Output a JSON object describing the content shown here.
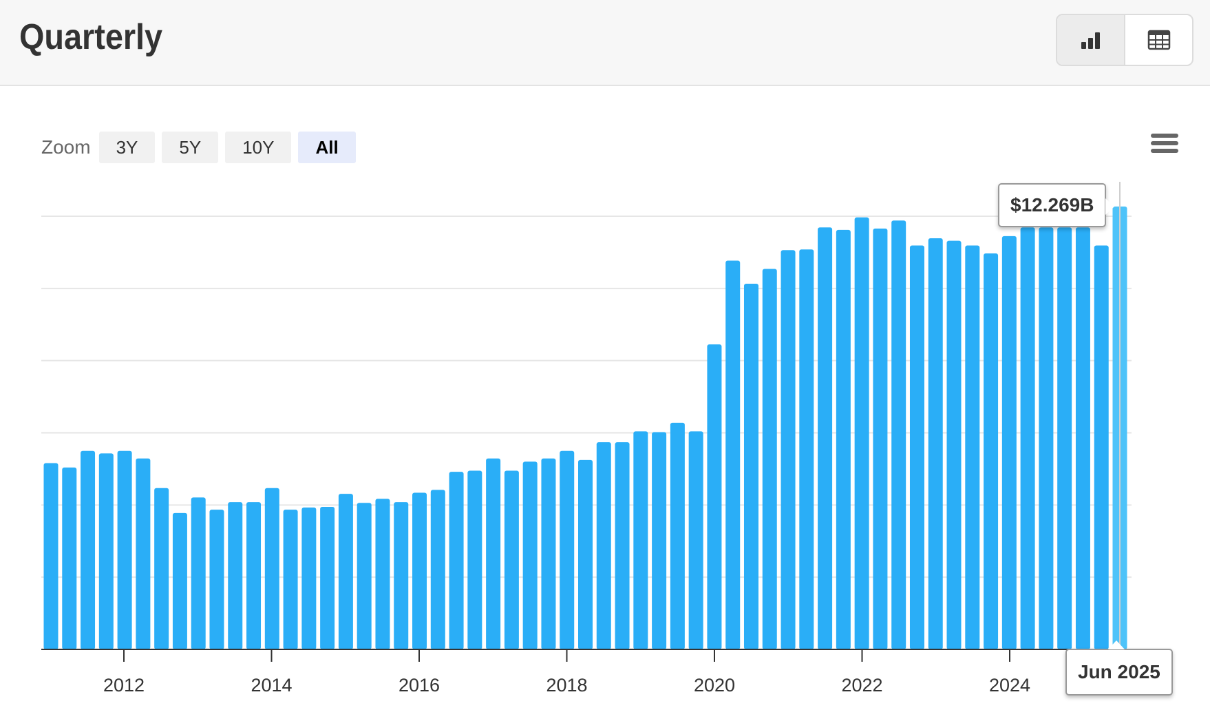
{
  "header": {
    "title": "Quarterly",
    "views": [
      {
        "name": "bar-chart-icon",
        "active": true
      },
      {
        "name": "table-icon",
        "active": false
      }
    ]
  },
  "zoom": {
    "label": "Zoom",
    "options": [
      "3Y",
      "5Y",
      "10Y",
      "All"
    ],
    "active": "All"
  },
  "menu": {
    "icon": "hamburger-menu-icon"
  },
  "tooltip": {
    "value": "$12.269B",
    "date": "Jun 2025"
  },
  "colors": {
    "bar": "#2aaef7",
    "highlight": "#4ec3f9",
    "grid": "#e6e6e6"
  },
  "chart_data": {
    "type": "bar",
    "title": "Quarterly",
    "xlabel": "",
    "ylabel": "",
    "x_ticks": [
      "2012",
      "2014",
      "2016",
      "2018",
      "2020",
      "2022",
      "2024"
    ],
    "x": [
      "Dec 2010",
      "Mar 2011",
      "Jun 2011",
      "Sep 2011",
      "Dec 2011",
      "Mar 2012",
      "Jun 2012",
      "Sep 2012",
      "Dec 2012",
      "Mar 2013",
      "Jun 2013",
      "Sep 2013",
      "Dec 2013",
      "Mar 2014",
      "Jun 2014",
      "Sep 2014",
      "Dec 2014",
      "Mar 2015",
      "Jun 2015",
      "Sep 2015",
      "Dec 2015",
      "Mar 2016",
      "Jun 2016",
      "Sep 2016",
      "Dec 2016",
      "Mar 2017",
      "Jun 2017",
      "Sep 2017",
      "Dec 2017",
      "Mar 2018",
      "Jun 2018",
      "Sep 2018",
      "Dec 2018",
      "Mar 2019",
      "Jun 2019",
      "Sep 2019",
      "Dec 2019",
      "Mar 2020",
      "Jun 2020",
      "Sep 2020",
      "Dec 2020",
      "Mar 2021",
      "Jun 2021",
      "Sep 2021",
      "Dec 2021",
      "Mar 2022",
      "Jun 2022",
      "Sep 2022",
      "Dec 2022",
      "Mar 2023",
      "Jun 2023",
      "Sep 2023",
      "Dec 2023",
      "Mar 2024",
      "Jun 2024",
      "Sep 2024",
      "Dec 2024",
      "Mar 2025",
      "Jun 2025"
    ],
    "values": [
      5.16,
      5.04,
      5.5,
      5.43,
      5.5,
      5.29,
      4.47,
      3.78,
      4.21,
      3.87,
      4.08,
      4.08,
      4.47,
      3.87,
      3.93,
      3.95,
      4.31,
      4.06,
      4.17,
      4.08,
      4.34,
      4.42,
      4.92,
      4.95,
      5.29,
      4.95,
      5.2,
      5.29,
      5.5,
      5.25,
      5.74,
      5.74,
      6.04,
      6.02,
      6.28,
      6.04,
      8.45,
      10.77,
      10.13,
      10.54,
      11.06,
      11.08,
      11.69,
      11.62,
      11.97,
      11.66,
      11.88,
      11.19,
      11.39,
      11.32,
      11.19,
      10.97,
      11.45,
      11.69,
      11.69,
      11.69,
      11.69,
      11.19,
      12.269
    ],
    "ylim": [
      0,
      12.0
    ],
    "grid": true,
    "legend": "none"
  }
}
